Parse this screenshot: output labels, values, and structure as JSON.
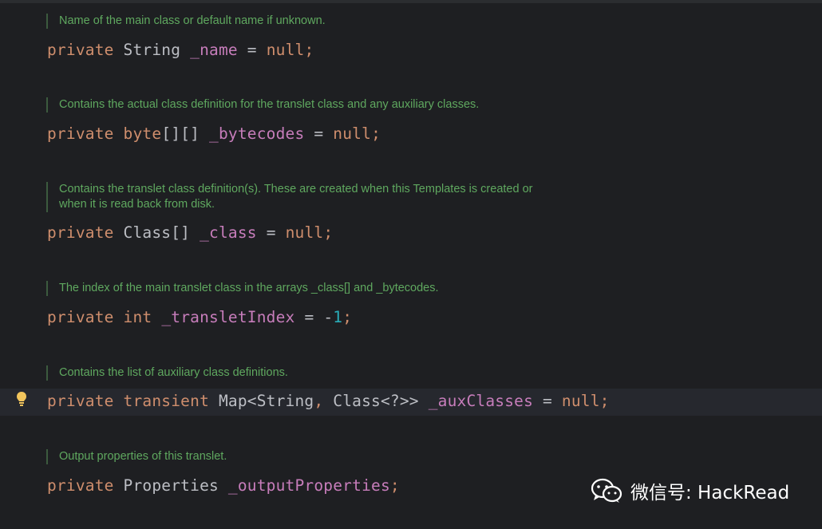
{
  "docs": [
    {
      "text": "Name of the main class or default name if unknown."
    },
    {
      "text": "Contains the actual class definition for the translet class and any auxiliary classes."
    },
    {
      "line1": "Contains the translet class definition(s). These are created when this Templates is created or",
      "line2": "when it is read back from disk."
    },
    {
      "text": "The index of the main translet class in the arrays _class[] and _bytecodes."
    },
    {
      "text": "Contains the list of auxiliary class definitions."
    },
    {
      "text": "Output properties of this translet."
    }
  ],
  "code": {
    "l1": {
      "kw": "private",
      "type": "String",
      "field": "_name",
      "eq": "=",
      "val": "null",
      "semi": ";"
    },
    "l2": {
      "kw": "private",
      "type_kw": "byte",
      "brackets": "[][]",
      "field": "_bytecodes",
      "eq": "=",
      "val": "null",
      "semi": ";"
    },
    "l3": {
      "kw": "private",
      "type": "Class[]",
      "field": "_class",
      "eq": "=",
      "val": "null",
      "semi": ";"
    },
    "l4": {
      "kw": "private",
      "type_kw": "int",
      "field": "_transletIndex",
      "eq": "= -",
      "num": "1",
      "semi": ";"
    },
    "l5": {
      "kw": "private",
      "kw2": "transient",
      "type": "Map<String",
      "comma": ",",
      "type2": "Class<?>>",
      "field": "_auxClasses",
      "eq": "=",
      "val": "null",
      "semi": ";"
    },
    "l6": {
      "kw": "private",
      "type": "Properties",
      "field": "_outputProperties",
      "semi": ";"
    }
  },
  "watermark": {
    "text": "微信号: HackRead"
  },
  "icons": {
    "bulb": "lightbulb-icon",
    "wechat": "wechat-icon"
  }
}
